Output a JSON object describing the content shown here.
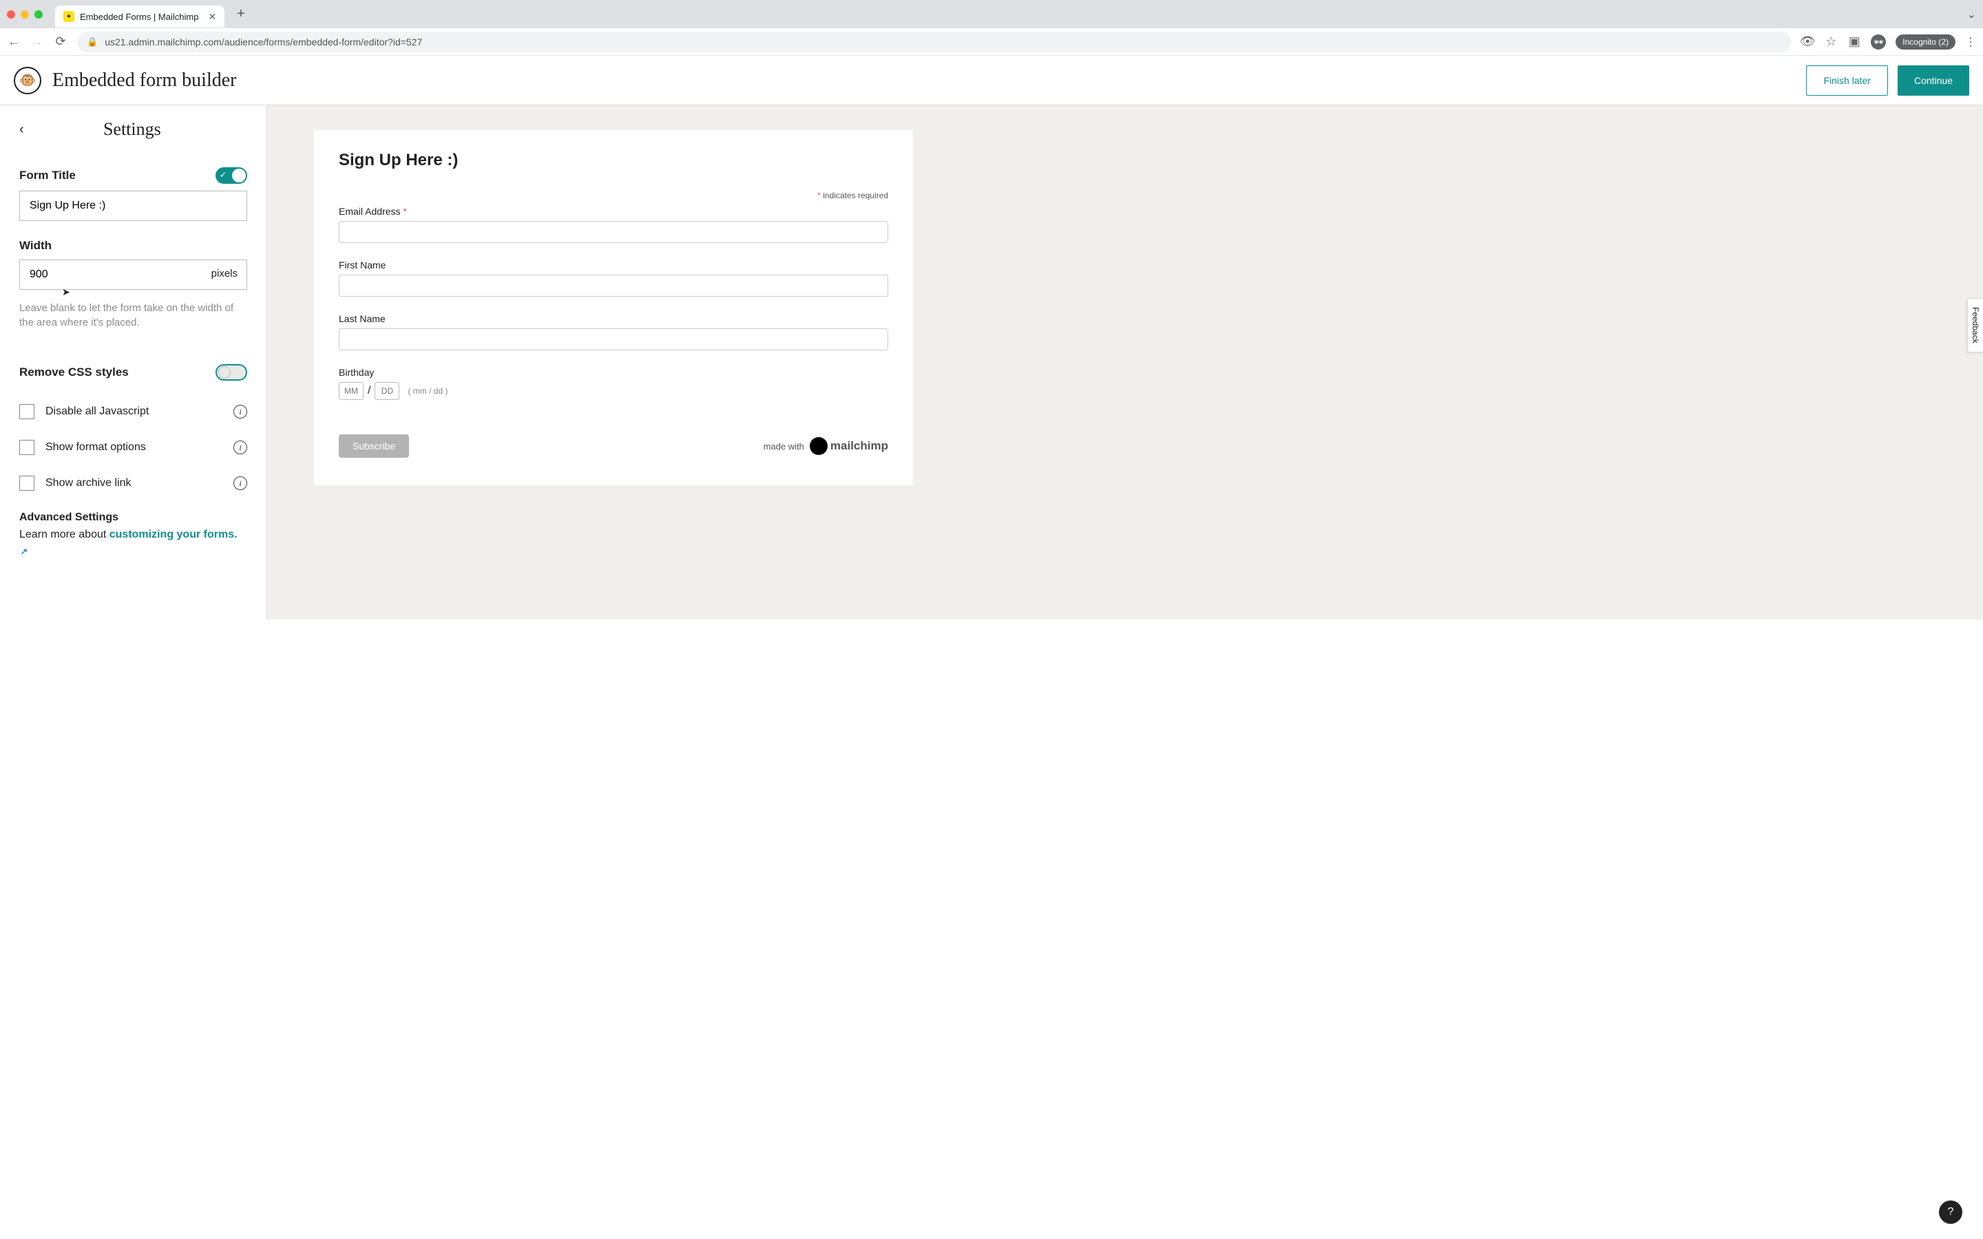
{
  "browser": {
    "tab_title": "Embedded Forms | Mailchimp",
    "url": "us21.admin.mailchimp.com/audience/forms/embedded-form/editor?id=527",
    "incognito_label": "Incognito (2)"
  },
  "header": {
    "title": "Embedded form builder",
    "finish_later": "Finish later",
    "continue": "Continue"
  },
  "sidebar": {
    "title": "Settings",
    "form_title_label": "Form Title",
    "form_title_value": "Sign Up Here :)",
    "width_label": "Width",
    "width_value": "900",
    "width_suffix": "pixels",
    "width_help": "Leave blank to let the form take on the width of the area where it's placed.",
    "remove_css_label": "Remove CSS styles",
    "cb_disable_js": "Disable all Javascript",
    "cb_format_options": "Show format options",
    "cb_archive_link": "Show archive link",
    "adv_header": "Advanced Settings",
    "adv_text_prefix": "Learn more about ",
    "adv_link": "customizing your forms."
  },
  "preview": {
    "heading": "Sign Up Here :)",
    "required_note": "indicates required",
    "fields": {
      "email_label": "Email Address",
      "first_name_label": "First Name",
      "last_name_label": "Last Name",
      "bday_label": "Birthday",
      "bday_mm_placeholder": "MM",
      "bday_dd_placeholder": "DD",
      "bday_hint": "( mm / dd )"
    },
    "subscribe_label": "Subscribe",
    "made_with": "made with",
    "brand": "mailchimp"
  },
  "feedback_label": "Feedback",
  "help_label": "?"
}
